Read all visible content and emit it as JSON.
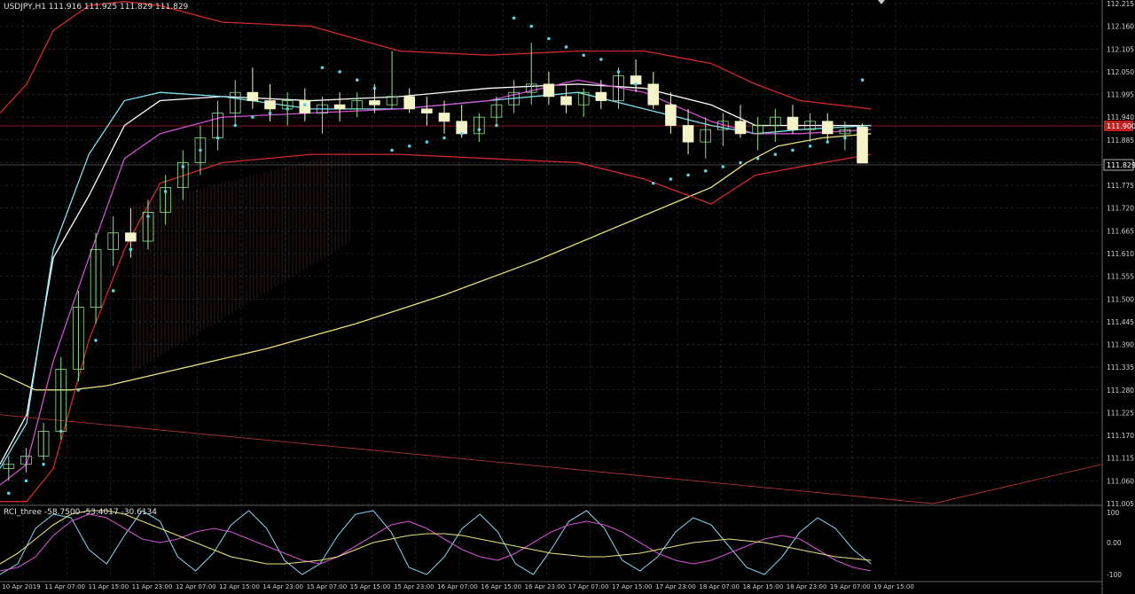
{
  "header": {
    "symbol_line": "USDJPY,H1  111.916 111.925 111.829 111.829"
  },
  "osc_header": {
    "label": "RCI_three -58.7500 -53.4017 -30.6134"
  },
  "prices": {
    "current_bid": "111.829",
    "current_red": "111.900"
  },
  "colors": {
    "background": "#000000",
    "grid": "#2e3a3a",
    "bull_candle": "#8fe38f",
    "bear_candle": "#f4f4c8",
    "ma_yellow": "#e8e27a",
    "bollinger_red": "#d22a2a",
    "envelope_pink": "#e6a0a0",
    "kijun_white": "#ffffff",
    "tenkan_cyan": "#7de0f0",
    "magenta": "#d050d0",
    "psar_dots": "#5fd0e0",
    "trend_line": "#b03030"
  },
  "chart_data": {
    "type": "line",
    "title": "USDJPY,H1",
    "ohlc_last": {
      "open": 111.916,
      "high": 111.925,
      "low": 111.829,
      "close": 111.829
    },
    "price_axis": {
      "ylim": [
        111.005,
        112.215
      ],
      "ticks": [
        "112.215",
        "112.160",
        "112.105",
        "112.050",
        "111.995",
        "111.940",
        "111.885",
        "111.830",
        "111.775",
        "111.720",
        "111.665",
        "111.610",
        "111.555",
        "111.500",
        "111.445",
        "111.390",
        "111.335",
        "111.280",
        "111.225",
        "111.170",
        "111.115",
        "111.060",
        "111.005"
      ]
    },
    "time_axis": {
      "ticks": [
        "10 Apr 2019",
        "11 Apr 07:00",
        "11 Apr 15:00",
        "11 Apr 23:00",
        "12 Apr 07:00",
        "12 Apr 15:00",
        "14 Apr 23:00",
        "15 Apr 07:00",
        "15 Apr 15:00",
        "15 Apr 23:00",
        "16 Apr 07:00",
        "16 Apr 15:00",
        "16 Apr 23:00",
        "17 Apr 07:00",
        "17 Apr 15:00",
        "17 Apr 23:00",
        "18 Apr 07:00",
        "18 Apr 15:00",
        "18 Apr 23:00",
        "19 Apr 07:00",
        "19 Apr 15:00"
      ]
    },
    "series": [
      {
        "name": "",
        "kind": "ma_yellow",
        "x": [
          0,
          8,
          16,
          24,
          40,
          60,
          80,
          100,
          120,
          140,
          160,
          168,
          175,
          180,
          185,
          196
        ],
        "y": [
          111.32,
          111.28,
          111.28,
          111.29,
          111.33,
          111.38,
          111.44,
          111.51,
          111.59,
          111.68,
          111.77,
          111.83,
          111.87,
          111.88,
          111.89,
          111.9
        ]
      },
      {
        "name": "",
        "kind": "bb_upper",
        "x": [
          0,
          6,
          12,
          20,
          28,
          36,
          50,
          70,
          90,
          110,
          130,
          145,
          160,
          170,
          180,
          196
        ],
        "y": [
          111.95,
          112.02,
          112.15,
          112.21,
          112.22,
          112.21,
          112.17,
          112.16,
          112.1,
          112.09,
          112.1,
          112.1,
          112.07,
          112.02,
          111.98,
          111.96
        ]
      },
      {
        "name": "",
        "kind": "bb_lower",
        "x": [
          0,
          6,
          12,
          20,
          28,
          36,
          50,
          70,
          90,
          110,
          130,
          145,
          160,
          170,
          180,
          196
        ],
        "y": [
          111.01,
          111.01,
          111.09,
          111.4,
          111.62,
          111.78,
          111.83,
          111.85,
          111.85,
          111.84,
          111.83,
          111.79,
          111.73,
          111.8,
          111.82,
          111.85
        ]
      },
      {
        "name": "",
        "kind": "kijun_white",
        "x": [
          0,
          6,
          12,
          20,
          28,
          36,
          50,
          70,
          90,
          110,
          130,
          145,
          160,
          170,
          180,
          196
        ],
        "y": [
          111.1,
          111.22,
          111.6,
          111.75,
          111.92,
          111.98,
          111.99,
          111.98,
          111.99,
          112.01,
          112.02,
          112.01,
          111.97,
          111.92,
          111.92,
          111.92
        ]
      },
      {
        "name": "",
        "kind": "tenkan_cyan",
        "x": [
          0,
          6,
          12,
          20,
          28,
          36,
          50,
          70,
          90,
          110,
          130,
          145,
          160,
          170,
          180,
          196
        ],
        "y": [
          111.09,
          111.2,
          111.62,
          111.85,
          111.98,
          112.0,
          111.99,
          111.96,
          111.96,
          111.98,
          112.0,
          111.96,
          111.92,
          111.9,
          111.91,
          111.92
        ]
      },
      {
        "name": "",
        "kind": "magenta",
        "x": [
          0,
          6,
          12,
          20,
          28,
          36,
          50,
          70,
          90,
          110,
          130,
          145,
          160,
          170,
          180,
          196
        ],
        "y": [
          111.05,
          111.1,
          111.35,
          111.6,
          111.84,
          111.9,
          111.94,
          111.95,
          111.96,
          111.98,
          112.03,
          112.0,
          111.93,
          111.9,
          111.9,
          111.91
        ]
      },
      {
        "name": "",
        "kind": "trend_line",
        "x": [
          0,
          210,
          248
        ],
        "y": [
          111.22,
          111.005,
          111.1
        ]
      }
    ],
    "candles": [
      {
        "o": 111.09,
        "h": 111.12,
        "l": 111.06,
        "c": 111.1
      },
      {
        "o": 111.1,
        "h": 111.14,
        "l": 111.08,
        "c": 111.12
      },
      {
        "o": 111.12,
        "h": 111.2,
        "l": 111.11,
        "c": 111.18
      },
      {
        "o": 111.18,
        "h": 111.36,
        "l": 111.16,
        "c": 111.33
      },
      {
        "o": 111.33,
        "h": 111.52,
        "l": 111.3,
        "c": 111.48
      },
      {
        "o": 111.48,
        "h": 111.66,
        "l": 111.44,
        "c": 111.62
      },
      {
        "o": 111.62,
        "h": 111.7,
        "l": 111.58,
        "c": 111.66
      },
      {
        "o": 111.66,
        "h": 111.72,
        "l": 111.6,
        "c": 111.64
      },
      {
        "o": 111.64,
        "h": 111.74,
        "l": 111.62,
        "c": 111.71
      },
      {
        "o": 111.71,
        "h": 111.8,
        "l": 111.68,
        "c": 111.77
      },
      {
        "o": 111.77,
        "h": 111.86,
        "l": 111.74,
        "c": 111.83
      },
      {
        "o": 111.83,
        "h": 111.92,
        "l": 111.8,
        "c": 111.89
      },
      {
        "o": 111.89,
        "h": 111.98,
        "l": 111.86,
        "c": 111.95
      },
      {
        "o": 111.95,
        "h": 112.03,
        "l": 111.92,
        "c": 112.0
      },
      {
        "o": 112.0,
        "h": 112.06,
        "l": 111.96,
        "c": 111.98
      },
      {
        "o": 111.98,
        "h": 112.02,
        "l": 111.93,
        "c": 111.96
      },
      {
        "o": 111.96,
        "h": 112.0,
        "l": 111.92,
        "c": 111.98
      },
      {
        "o": 111.98,
        "h": 112.01,
        "l": 111.93,
        "c": 111.95
      },
      {
        "o": 111.95,
        "h": 111.99,
        "l": 111.9,
        "c": 111.97
      },
      {
        "o": 111.97,
        "h": 112.0,
        "l": 111.93,
        "c": 111.96
      },
      {
        "o": 111.96,
        "h": 112.0,
        "l": 111.94,
        "c": 111.98
      },
      {
        "o": 111.98,
        "h": 112.02,
        "l": 111.95,
        "c": 111.97
      },
      {
        "o": 111.97,
        "h": 112.1,
        "l": 111.96,
        "c": 111.99
      },
      {
        "o": 111.99,
        "h": 112.01,
        "l": 111.95,
        "c": 111.96
      },
      {
        "o": 111.96,
        "h": 111.99,
        "l": 111.92,
        "c": 111.95
      },
      {
        "o": 111.95,
        "h": 111.98,
        "l": 111.9,
        "c": 111.93
      },
      {
        "o": 111.93,
        "h": 111.97,
        "l": 111.89,
        "c": 111.9
      },
      {
        "o": 111.9,
        "h": 111.95,
        "l": 111.88,
        "c": 111.94
      },
      {
        "o": 111.94,
        "h": 111.99,
        "l": 111.92,
        "c": 111.97
      },
      {
        "o": 111.97,
        "h": 112.03,
        "l": 111.95,
        "c": 112.0
      },
      {
        "o": 112.0,
        "h": 112.12,
        "l": 111.97,
        "c": 112.02
      },
      {
        "o": 112.02,
        "h": 112.05,
        "l": 111.97,
        "c": 111.99
      },
      {
        "o": 111.99,
        "h": 112.02,
        "l": 111.95,
        "c": 111.97
      },
      {
        "o": 111.97,
        "h": 112.01,
        "l": 111.94,
        "c": 112.0
      },
      {
        "o": 112.0,
        "h": 112.03,
        "l": 111.96,
        "c": 111.98
      },
      {
        "o": 111.98,
        "h": 112.06,
        "l": 111.96,
        "c": 112.04
      },
      {
        "o": 112.04,
        "h": 112.08,
        "l": 112.0,
        "c": 112.02
      },
      {
        "o": 112.02,
        "h": 112.05,
        "l": 111.96,
        "c": 111.97
      },
      {
        "o": 111.97,
        "h": 112.0,
        "l": 111.9,
        "c": 111.92
      },
      {
        "o": 111.92,
        "h": 111.96,
        "l": 111.85,
        "c": 111.88
      },
      {
        "o": 111.88,
        "h": 111.94,
        "l": 111.84,
        "c": 111.91
      },
      {
        "o": 111.91,
        "h": 111.95,
        "l": 111.87,
        "c": 111.93
      },
      {
        "o": 111.93,
        "h": 111.97,
        "l": 111.89,
        "c": 111.9
      },
      {
        "o": 111.9,
        "h": 111.94,
        "l": 111.86,
        "c": 111.92
      },
      {
        "o": 111.92,
        "h": 111.96,
        "l": 111.88,
        "c": 111.94
      },
      {
        "o": 111.94,
        "h": 111.97,
        "l": 111.9,
        "c": 111.91
      },
      {
        "o": 111.91,
        "h": 111.95,
        "l": 111.88,
        "c": 111.93
      },
      {
        "o": 111.93,
        "h": 111.95,
        "l": 111.88,
        "c": 111.9
      },
      {
        "o": 111.9,
        "h": 111.93,
        "l": 111.86,
        "c": 111.91
      },
      {
        "o": 111.916,
        "h": 111.925,
        "l": 111.829,
        "c": 111.829
      }
    ],
    "psar": [
      111.03,
      111.06,
      111.1,
      111.18,
      111.28,
      111.4,
      111.52,
      111.62,
      111.7,
      111.76,
      111.82,
      111.86,
      111.89,
      111.92,
      111.94,
      111.95,
      111.96,
      111.97,
      112.06,
      112.05,
      112.03,
      112.01,
      111.86,
      111.87,
      111.88,
      111.89,
      111.9,
      111.91,
      111.92,
      112.18,
      112.16,
      112.13,
      112.11,
      112.09,
      112.08,
      112.05,
      112.02,
      111.78,
      111.79,
      111.8,
      111.81,
      111.82,
      111.83,
      111.84,
      111.85,
      111.86,
      111.87,
      111.88,
      111.89,
      112.03
    ],
    "oscillator": {
      "ylim": [
        -100,
        100
      ],
      "ticks": [
        "100",
        "0.00",
        "-100"
      ],
      "series": [
        {
          "name": "",
          "color": "#7dc8e0",
          "y": [
            -90,
            -60,
            40,
            80,
            70,
            -20,
            -60,
            20,
            90,
            60,
            -40,
            -80,
            -30,
            50,
            90,
            40,
            -50,
            -90,
            -60,
            20,
            80,
            90,
            30,
            -70,
            -90,
            -40,
            40,
            80,
            30,
            -60,
            -90,
            -20,
            60,
            90,
            40,
            -50,
            -80,
            -40,
            30,
            70,
            50,
            -10,
            -70,
            -90,
            -40,
            30,
            70,
            40,
            -20,
            -60
          ]
        },
        {
          "name": "",
          "color": "#d050d0",
          "y": [
            -80,
            -70,
            -40,
            20,
            60,
            80,
            70,
            40,
            10,
            0,
            10,
            30,
            40,
            30,
            10,
            -10,
            -30,
            -50,
            -60,
            -40,
            -10,
            20,
            50,
            60,
            40,
            10,
            -20,
            -40,
            -50,
            -30,
            0,
            30,
            50,
            60,
            50,
            30,
            0,
            -30,
            -50,
            -60,
            -50,
            -30,
            -10,
            10,
            20,
            10,
            -20,
            -50,
            -70,
            -80
          ]
        },
        {
          "name": "",
          "color": "#e8e27a",
          "y": [
            -60,
            -30,
            10,
            50,
            80,
            90,
            90,
            80,
            60,
            40,
            20,
            0,
            -20,
            -40,
            -50,
            -60,
            -60,
            -55,
            -50,
            -40,
            -20,
            0,
            10,
            20,
            25,
            25,
            20,
            10,
            0,
            -10,
            -20,
            -30,
            -35,
            -40,
            -40,
            -35,
            -30,
            -20,
            -10,
            0,
            5,
            10,
            5,
            0,
            -10,
            -20,
            -30,
            -40,
            -45,
            -50
          ]
        }
      ]
    }
  }
}
